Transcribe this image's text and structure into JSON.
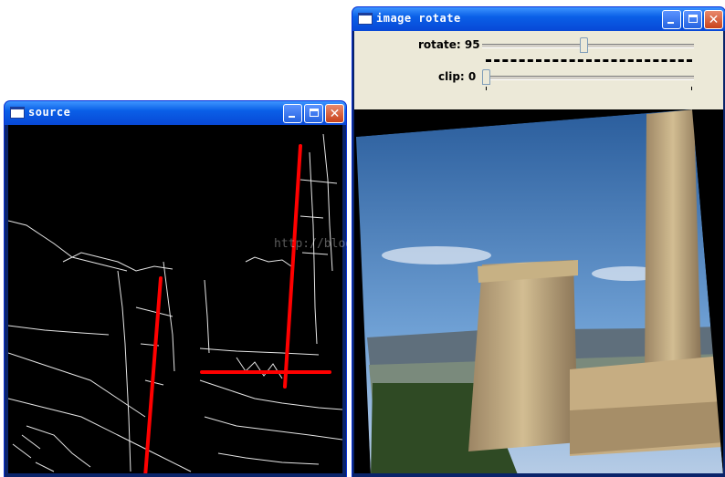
{
  "windows": {
    "source": {
      "title": "source"
    },
    "rotate": {
      "title": "image rotate",
      "rotate_label": "rotate: 95",
      "rotate_value": 95,
      "clip_label": "clip: 0",
      "clip_value": 0
    }
  },
  "watermark": "http://blog.csdn.net/",
  "colors": {
    "titlebar": "#0a5fe7",
    "close_button": "#c8421b",
    "hough_lines": "#ff0000",
    "dialog_bg": "#ece9d8"
  },
  "icons": {
    "minimize": "minimize-icon",
    "maximize": "maximize-icon",
    "close": "close-icon",
    "window": "window-icon"
  }
}
